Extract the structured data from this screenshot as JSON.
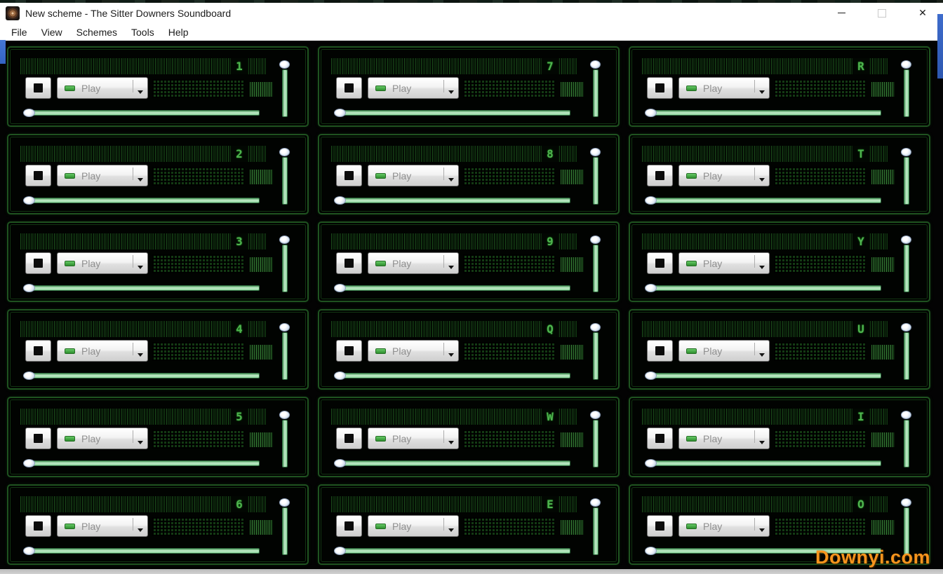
{
  "window": {
    "title": "New scheme - The Sitter Downers Soundboard",
    "controls": {
      "minimize": "minimize",
      "maximize": "maximize",
      "close": "✕"
    }
  },
  "menu": {
    "items": [
      "File",
      "View",
      "Schemes",
      "Tools",
      "Help"
    ]
  },
  "board": {
    "play_label": "Play",
    "hotkeys": [
      "1",
      "7",
      "R",
      "2",
      "8",
      "T",
      "3",
      "9",
      "Y",
      "4",
      "Q",
      "U",
      "5",
      "W",
      "I",
      "6",
      "E",
      "O"
    ],
    "rows": 6,
    "columns": 3
  },
  "watermark": "Downyi.com",
  "colors": {
    "panel_border_green": "#1f5220",
    "led_text_green": "#4fb44f",
    "slider_track_green": "#9ddcaa",
    "play_led_green": "#3aa03a",
    "watermark_orange": "#f7941d",
    "titlebar_bg": "#ffffff",
    "content_bg": "#030303",
    "desktop_sliver_blue": "#3a6fd0"
  }
}
